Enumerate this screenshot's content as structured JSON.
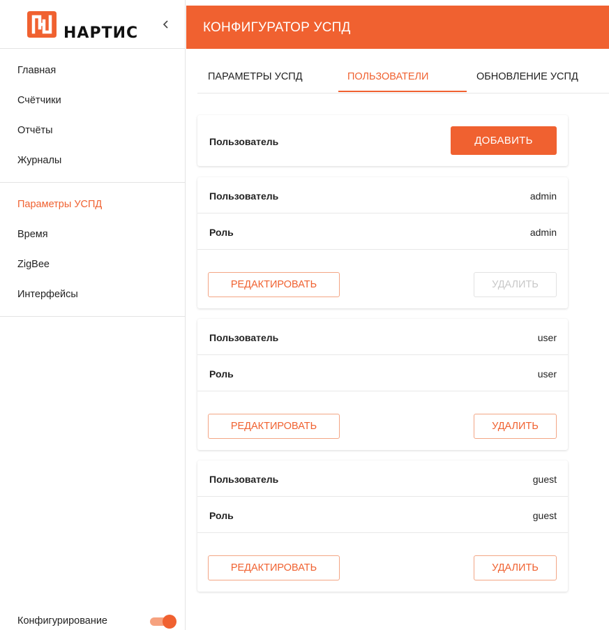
{
  "brand": {
    "logo_text": "НАРТИС",
    "accent_color": "#f06130",
    "logo_icon": "nartis-logo-icon"
  },
  "sidebar": {
    "collapse_icon": "chevron-left-icon",
    "group1": [
      {
        "label": "Главная"
      },
      {
        "label": "Счётчики"
      },
      {
        "label": "Отчёты"
      },
      {
        "label": "Журналы"
      }
    ],
    "group2": [
      {
        "label": "Параметры УСПД",
        "active": true
      },
      {
        "label": "Время"
      },
      {
        "label": "ZigBee"
      },
      {
        "label": "Интерфейсы"
      }
    ],
    "config": {
      "label": "Конфигурирование",
      "toggle_on": true
    }
  },
  "header": {
    "title": "КОНФИГУРАТОР УСПД"
  },
  "tabs": [
    {
      "label": "ПАРАМЕТРЫ УСПД"
    },
    {
      "label": "ПОЛЬЗОВАТЕЛИ",
      "active": true
    },
    {
      "label": "ОБНОВЛЕНИЕ УСПД"
    }
  ],
  "add_card": {
    "label": "Пользователь",
    "button": "ДОБАВИТЬ"
  },
  "users": [
    {
      "user_label": "Пользователь",
      "user_value": "admin",
      "role_label": "Роль",
      "role_value": "admin",
      "edit_label": "РЕДАКТИРОВАТЬ",
      "delete_label": "УДАЛИТЬ",
      "delete_disabled": true
    },
    {
      "user_label": "Пользователь",
      "user_value": "user",
      "role_label": "Роль",
      "role_value": "user",
      "edit_label": "РЕДАКТИРОВАТЬ",
      "delete_label": "УДАЛИТЬ",
      "delete_disabled": false
    },
    {
      "user_label": "Пользователь",
      "user_value": "guest",
      "role_label": "Роль",
      "role_value": "guest",
      "edit_label": "РЕДАКТИРОВАТЬ",
      "delete_label": "УДАЛИТЬ",
      "delete_disabled": false
    }
  ]
}
